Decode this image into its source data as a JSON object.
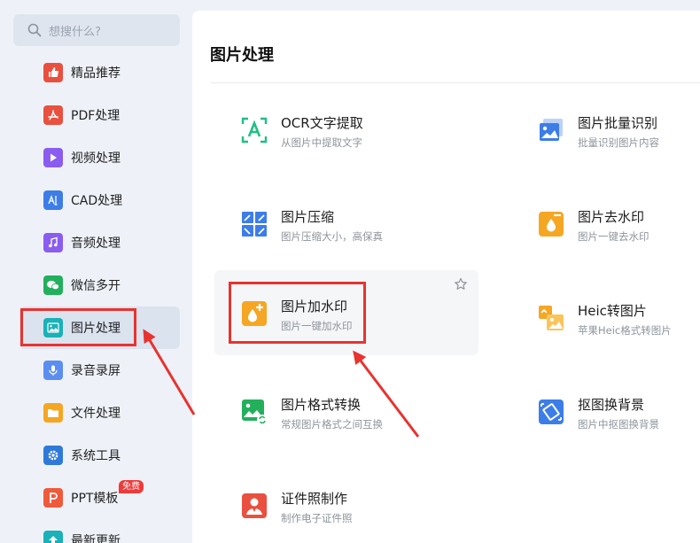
{
  "search": {
    "placeholder": "想搜什么?"
  },
  "sidebar": {
    "items": [
      {
        "label": "精品推荐",
        "icon": "thumbs-up-icon",
        "color": "#e9503f"
      },
      {
        "label": "PDF处理",
        "icon": "pdf-icon",
        "color": "#e9503f"
      },
      {
        "label": "视频处理",
        "icon": "play-icon",
        "color": "#8a5cf0"
      },
      {
        "label": "CAD处理",
        "icon": "cad-icon",
        "color": "#3d7de8"
      },
      {
        "label": "音频处理",
        "icon": "music-icon",
        "color": "#8a5cf0"
      },
      {
        "label": "微信多开",
        "icon": "wechat-icon",
        "color": "#22b05c"
      },
      {
        "label": "图片处理",
        "icon": "image-icon",
        "color": "#1ab1b8"
      },
      {
        "label": "录音录屏",
        "icon": "microphone-icon",
        "color": "#5b8ef0"
      },
      {
        "label": "文件处理",
        "icon": "folder-icon",
        "color": "#f5a623"
      },
      {
        "label": "系统工具",
        "icon": "gear-icon",
        "color": "#2f7ad8"
      },
      {
        "label": "PPT模板",
        "icon": "ppt-icon",
        "color": "#ef5a3b",
        "badge": "免费"
      },
      {
        "label": "最新更新",
        "icon": "update-icon",
        "color": "#1ab1b8"
      }
    ]
  },
  "main": {
    "title": "图片处理",
    "tools": [
      {
        "title": "OCR文字提取",
        "subtitle": "从图片中提取文字",
        "icon": "ocr-icon"
      },
      {
        "title": "图片批量识别",
        "subtitle": "批量识别图片内容",
        "icon": "batch-recognize-icon"
      },
      {
        "title": "图片压缩",
        "subtitle": "图片压缩大小，高保真",
        "icon": "compress-icon"
      },
      {
        "title": "图片去水印",
        "subtitle": "图片一键去水印",
        "icon": "remove-watermark-icon"
      },
      {
        "title": "图片加水印",
        "subtitle": "图片一键加水印",
        "icon": "add-watermark-icon"
      },
      {
        "title": "Heic转图片",
        "subtitle": "苹果Heic格式转图片",
        "icon": "heic-convert-icon"
      },
      {
        "title": "图片格式转换",
        "subtitle": "常规图片格式之间互换",
        "icon": "format-convert-icon"
      },
      {
        "title": "抠图换背景",
        "subtitle": "图片中抠图换背景",
        "icon": "cutout-icon"
      },
      {
        "title": "证件照制作",
        "subtitle": "制作电子证件照",
        "icon": "id-photo-icon"
      }
    ]
  },
  "colors": {
    "accent": "#e8332f",
    "green": "#22b05c",
    "blue": "#3d7de8",
    "orange": "#f5a623"
  }
}
